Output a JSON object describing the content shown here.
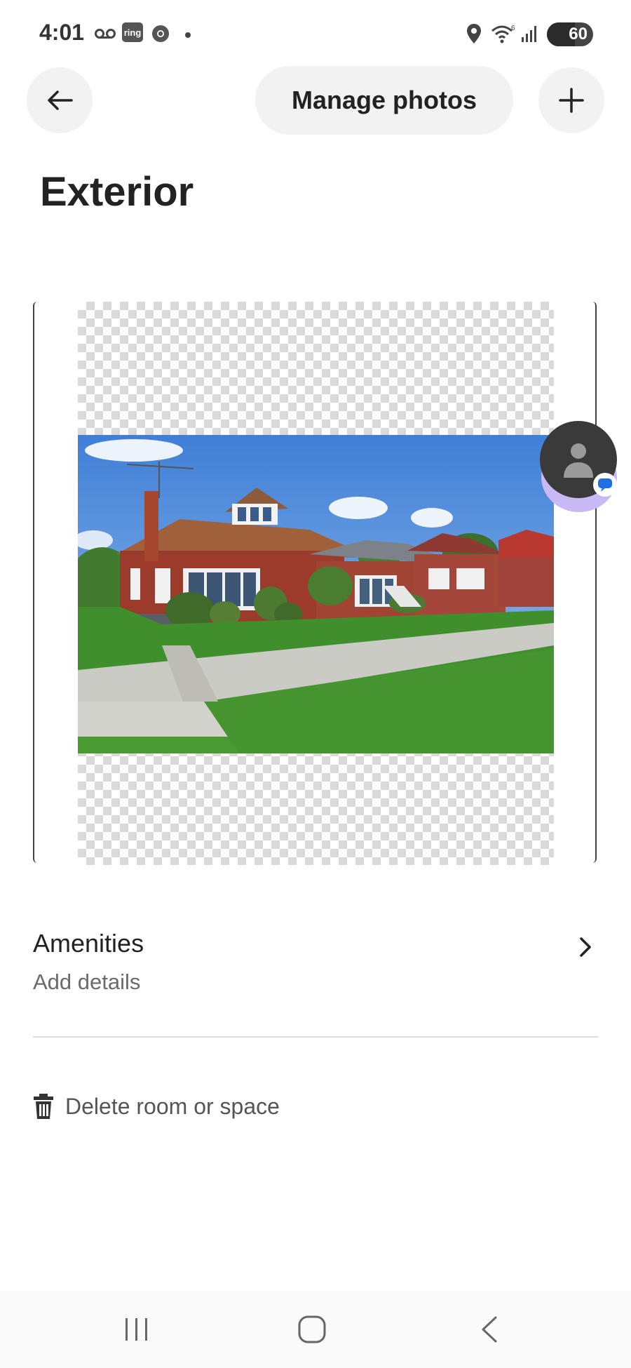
{
  "status_bar": {
    "time": "4:01",
    "ring_badge": "ring",
    "battery_level": "60",
    "icons": [
      "voicemail-icon",
      "ring-icon",
      "chrome-icon",
      "notification-dot",
      "location-icon",
      "wifi-icon",
      "signal-icon",
      "battery-icon"
    ]
  },
  "header": {
    "back_icon": "arrow-left-icon",
    "manage_photos_label": "Manage photos",
    "add_icon": "plus-icon"
  },
  "page": {
    "title": "Exterior"
  },
  "photo": {
    "description_icon": "house-photo",
    "background": "transparent-checkerboard"
  },
  "amenities": {
    "title": "Amenities",
    "subtitle": "Add details",
    "chevron_icon": "chevron-right-icon"
  },
  "delete": {
    "label": "Delete room or space",
    "icon": "trash-icon"
  },
  "chat_head": {
    "icon": "person-avatar-icon",
    "badge_icon": "message-icon"
  },
  "nav_bar": {
    "buttons": [
      "recents-icon",
      "home-icon",
      "back-icon"
    ]
  },
  "colors": {
    "text_primary": "#222222",
    "text_secondary": "#6a6a6a",
    "button_bg": "#f2f2f2",
    "divider": "#dddddd",
    "chat_glow": "#c8b8f4"
  }
}
